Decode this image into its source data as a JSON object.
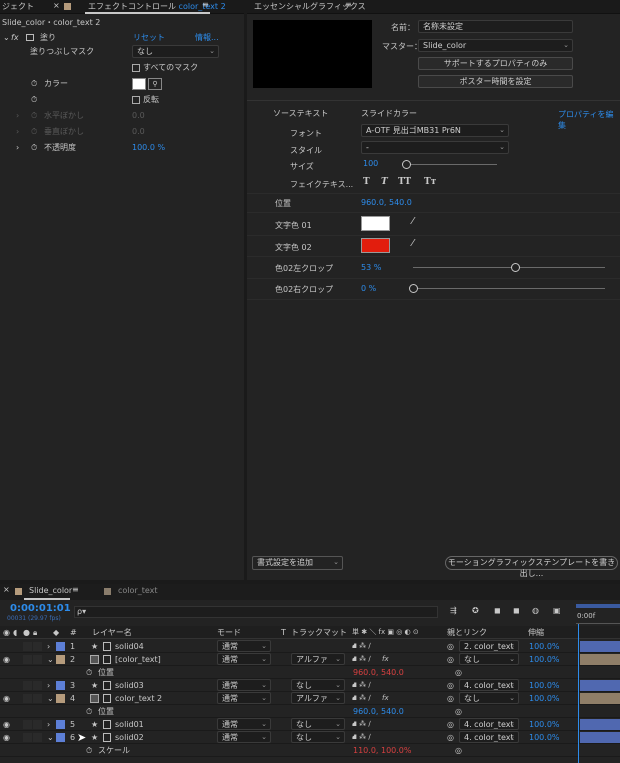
{
  "colors": {
    "accent": "#2d8ceb",
    "label_blue": "#5d7fd6",
    "label_tan": "#b59b7c",
    "red_value": "#d74040",
    "swatch_red": "#e21d0d",
    "swatch_white": "#ffffff",
    "track_bar_blue": "#5068b0",
    "track_bar_tan": "#8f7e68"
  },
  "effect_panel": {
    "tab_project": "ジェクト",
    "tab_effect": "エフェクトコントロール",
    "tab_effect_comp": "color_text 2",
    "breadcrumb": "Slide_color・color_text 2",
    "fx_name": "塗り",
    "reset": "リセット",
    "info": "情報...",
    "rows": [
      {
        "label": "塗りつぶしマスク",
        "value": "なし"
      },
      {
        "checkbox": "すべてのマスク"
      },
      {
        "label": "カラー"
      },
      {
        "checkbox": "反転"
      },
      {
        "label": "水平ぼかし",
        "value": "0.0",
        "disabled": true
      },
      {
        "label": "垂直ぼかし",
        "value": "0.0",
        "disabled": true
      },
      {
        "label": "不透明度",
        "value": "100.0 %"
      }
    ]
  },
  "eg_panel": {
    "tab_title": "エッセンシャルグラフィックス",
    "name_label": "名前：",
    "name_value": "名称未設定",
    "master_label": "マスター：",
    "master_value": "Slide_color",
    "btn_support": "サポートするプロパティのみ",
    "btn_poster": "ポスター時間を設定",
    "source_text": "ソーステキスト",
    "source_name": "スライドカラー",
    "edit_props": "プロパティを編集",
    "font_label": "フォント",
    "font_value": "A-OTF 見出ゴMB31 Pr6N",
    "style_label": "スタイル",
    "style_value": "-",
    "size_label": "サイズ",
    "size_value": "100",
    "size_slider": 0.0,
    "faux_label": "フェイクテキス...",
    "faux_buttons": [
      "T",
      "T",
      "TT",
      "Tт"
    ],
    "pos_label": "位置",
    "pos_value": "960.0, 540.0",
    "col1_label": "文字色 01",
    "col2_label": "文字色 02",
    "crop_left_label": "色02左クロップ",
    "crop_left_value": "53 %",
    "crop_left_level": 0.53,
    "crop_right_label": "色02右クロップ",
    "crop_right_value": "0 %",
    "crop_right_level": 0.0,
    "add_format": "書式設定を追加",
    "export_btn": "モーショングラフィックステンプレートを書き出し..."
  },
  "timeline": {
    "tab1": "Slide_color",
    "tab2": "color_text",
    "timecode": "0:00:01:01",
    "fps": "00031 (29.97 fps)",
    "search_placeholder": "ρ▾",
    "ruler_label": "0:00f",
    "headers": {
      "num": "#",
      "name": "レイヤー名",
      "mode": "モード",
      "track": "T",
      "matte": "トラックマット",
      "switches": "単 ✱ ＼ fx ▣ ◎ ◐ ⊙",
      "parent": "親とリンク",
      "stretch": "伸縮"
    },
    "layers": [
      {
        "num": "1",
        "name": "solid04",
        "star": true,
        "mode": "通常",
        "matte": "",
        "parent": "2. color_text",
        "stretch": "100.0%",
        "label": "blue",
        "eye": false,
        "expanded": false,
        "bar": "blue"
      },
      {
        "num": "2",
        "name": "[color_text]",
        "star": false,
        "mode": "通常",
        "matte": "アルファ",
        "parent": "なし",
        "stretch": "100.0%",
        "label": "tan",
        "eye": true,
        "expanded": true,
        "bar": "tan"
      },
      {
        "sub": true,
        "name": "位置",
        "value": "960.0, 540.0",
        "red": true
      },
      {
        "num": "3",
        "name": "solid03",
        "star": true,
        "mode": "通常",
        "matte": "なし",
        "parent": "4. color_text",
        "stretch": "100.0%",
        "label": "blue",
        "eye": false,
        "expanded": false,
        "bar": "blue"
      },
      {
        "num": "4",
        "name": "color_text 2",
        "star": false,
        "mode": "通常",
        "matte": "アルファ",
        "parent": "なし",
        "stretch": "100.0%",
        "label": "tan",
        "eye": true,
        "expanded": true,
        "bar": "tan"
      },
      {
        "sub": true,
        "name": "位置",
        "value": "960.0, 540.0",
        "red": false
      },
      {
        "num": "5",
        "name": "solid01",
        "star": true,
        "mode": "通常",
        "matte": "なし",
        "parent": "4. color_text",
        "stretch": "100.0%",
        "label": "blue",
        "eye": true,
        "expanded": false,
        "bar": "blue"
      },
      {
        "num": "6",
        "name": "solid02",
        "star": true,
        "mode": "通常",
        "matte": "なし",
        "parent": "4. color_text",
        "stretch": "100.0%",
        "label": "blue",
        "eye": true,
        "expanded": true,
        "bar": "blue"
      },
      {
        "sub": true,
        "name": "スケール",
        "value": "110.0, 100.0%",
        "red": true
      }
    ]
  }
}
